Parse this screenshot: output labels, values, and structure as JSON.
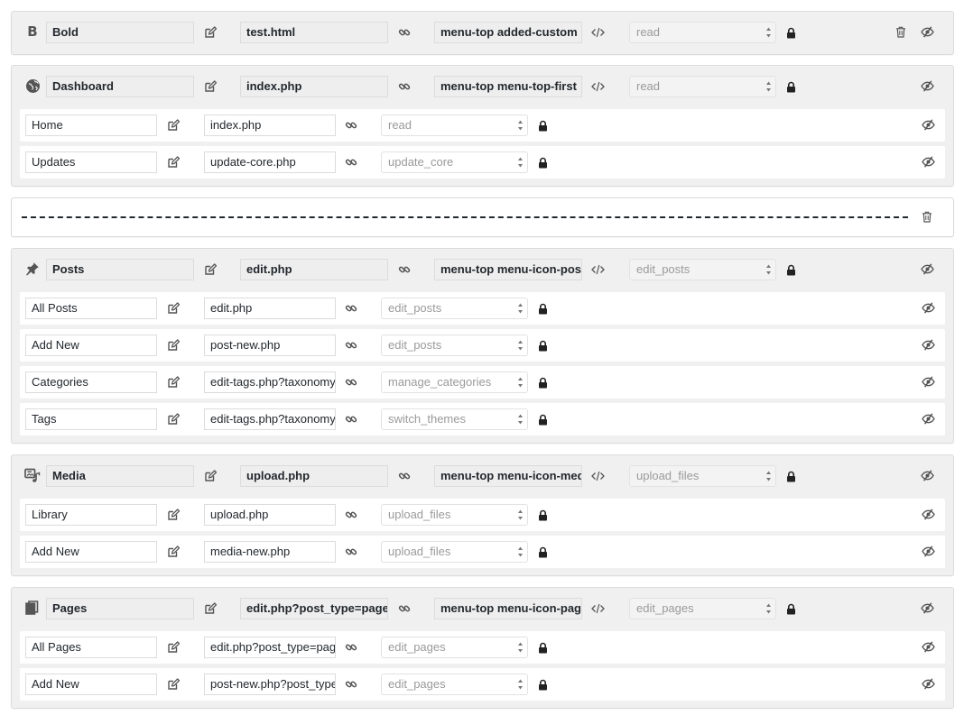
{
  "menu_groups": [
    {
      "type": "menu",
      "icon": "bold-b-icon",
      "icon_text": "B",
      "title": "Bold",
      "url": "test.html",
      "css_class": "menu-top added-custom",
      "capability": "read",
      "has_delete": true,
      "children": []
    },
    {
      "type": "menu",
      "icon": "dashboard-icon",
      "title": "Dashboard",
      "url": "index.php",
      "css_class": "menu-top menu-top-first",
      "capability": "read",
      "has_delete": false,
      "children": [
        {
          "title": "Home",
          "url": "index.php",
          "capability": "read"
        },
        {
          "title": "Updates",
          "url": "update-core.php",
          "capability": "update_core"
        }
      ]
    },
    {
      "type": "separator",
      "has_delete": true
    },
    {
      "type": "menu",
      "icon": "pin-icon",
      "title": "Posts",
      "url": "edit.php",
      "css_class": "menu-top menu-icon-post",
      "capability": "edit_posts",
      "has_delete": false,
      "children": [
        {
          "title": "All Posts",
          "url": "edit.php",
          "capability": "edit_posts"
        },
        {
          "title": "Add New",
          "url": "post-new.php",
          "capability": "edit_posts"
        },
        {
          "title": "Categories",
          "url": "edit-tags.php?taxonomy=category",
          "capability": "manage_categories"
        },
        {
          "title": "Tags",
          "url": "edit-tags.php?taxonomy=post_tag",
          "capability": "switch_themes"
        }
      ]
    },
    {
      "type": "menu",
      "icon": "media-icon",
      "title": "Media",
      "url": "upload.php",
      "css_class": "menu-top menu-icon-media",
      "capability": "upload_files",
      "has_delete": false,
      "children": [
        {
          "title": "Library",
          "url": "upload.php",
          "capability": "upload_files"
        },
        {
          "title": "Add New",
          "url": "media-new.php",
          "capability": "upload_files"
        }
      ]
    },
    {
      "type": "menu",
      "icon": "pages-icon",
      "title": "Pages",
      "url": "edit.php?post_type=page",
      "css_class": "menu-top menu-icon-page",
      "capability": "edit_pages",
      "has_delete": false,
      "children": [
        {
          "title": "All Pages",
          "url": "edit.php?post_type=page",
          "capability": "edit_pages"
        },
        {
          "title": "Add New",
          "url": "post-new.php?post_type=page",
          "capability": "edit_pages"
        }
      ]
    }
  ],
  "row_icons": {
    "rename": "pencil-edit-icon",
    "url": "link-icon",
    "css_class": "code-icon",
    "lock": "lock-icon",
    "visibility": "eye-slash-icon",
    "delete": "trash-icon"
  },
  "colors": {
    "group_bg": "#f0f0f0",
    "row_bg": "#ffffff",
    "readonly_input_bg": "#eeeeee",
    "icon": "#555555",
    "text": "#23282d",
    "placeholder_text": "#9a9a9a"
  }
}
